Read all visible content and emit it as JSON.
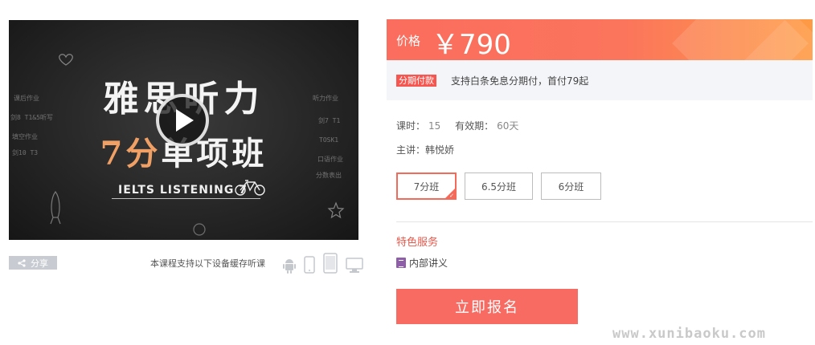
{
  "video": {
    "title_line1": "雅思听力",
    "title_line2_highlight": "7分",
    "title_line2_rest": "单项班",
    "subtitle": "IELTS LISTENING 7",
    "chalk_notes": [
      "课后作业",
      "剑7 T1",
      "TOSK1",
      "口语作业",
      "分数表出",
      "听力作业",
      "剑8 T1&5听写",
      "填空作业",
      "剑10 T3"
    ]
  },
  "below_video": {
    "share_label": "分享",
    "cache_text": "本课程支持以下设备缓存听课",
    "devices": [
      "android-icon",
      "phone-icon",
      "tablet-icon",
      "desktop-icon"
    ]
  },
  "price": {
    "label": "价格",
    "value": "￥790"
  },
  "installment": {
    "tag": "分期付款",
    "text": "支持白条免息分期付，首付79起"
  },
  "meta": {
    "lessons_label": "课时：",
    "lessons_value": "15",
    "validity_label": "有效期：",
    "validity_value": "60天",
    "teacher": "主讲：韩悦娇"
  },
  "options": [
    {
      "label": "7分班",
      "selected": true
    },
    {
      "label": "6.5分班",
      "selected": false
    },
    {
      "label": "6分班",
      "selected": false
    }
  ],
  "features": {
    "title": "特色服务",
    "items": [
      {
        "label": "内部讲义"
      }
    ]
  },
  "enroll_button": "立即报名",
  "watermark": "www.xunibaoku.com",
  "colors": {
    "accent": "#f86b62",
    "price_gradient_start": "#fb6d5e",
    "price_gradient_end": "#fe9b45",
    "feature_title": "#e8584b"
  }
}
